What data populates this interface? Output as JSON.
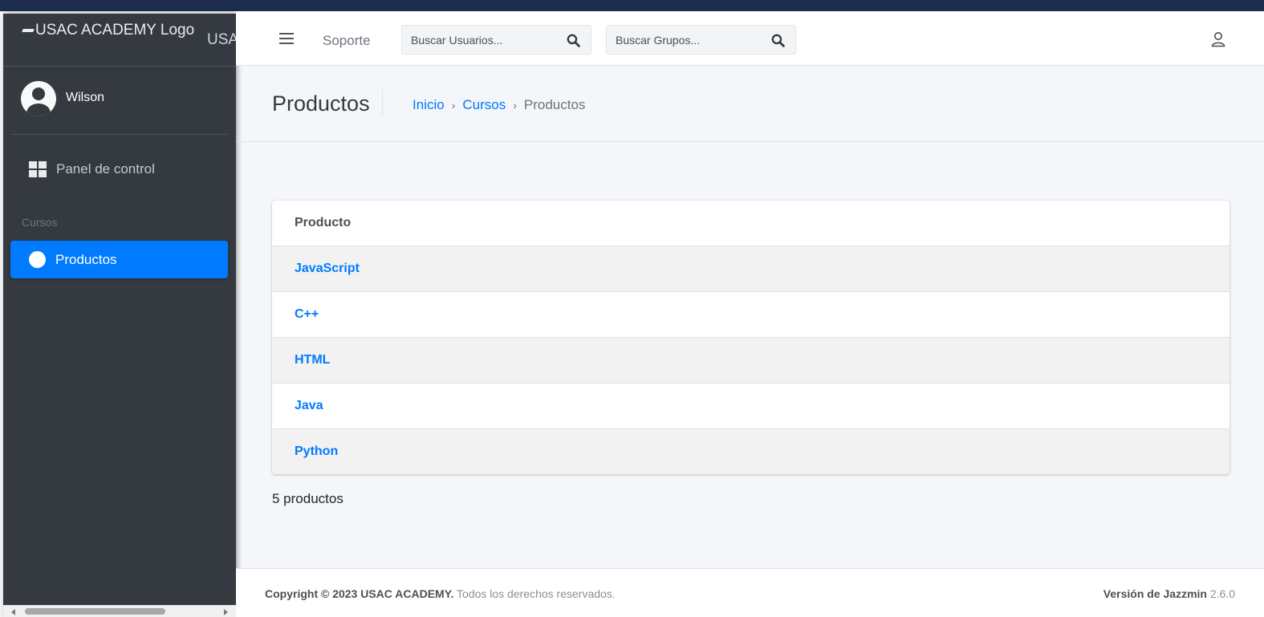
{
  "sidebar": {
    "brand_logo_alt": "USAC ACADEMY Logo",
    "brand_text": "USAC ACADEMY",
    "user_name": "Wilson",
    "dashboard_label": "Panel de control",
    "section_header": "Cursos",
    "active_item_label": "Productos"
  },
  "topnav": {
    "support_label": "Soporte",
    "search_users_placeholder": "Buscar Usuarios...",
    "search_groups_placeholder": "Buscar Grupos..."
  },
  "header": {
    "title": "Productos",
    "breadcrumb": [
      "Inicio",
      "Cursos",
      "Productos"
    ],
    "breadcrumb_sep": "›"
  },
  "table": {
    "header": "Producto",
    "rows": [
      "JavaScript",
      "C++",
      "HTML",
      "Java",
      "Python"
    ]
  },
  "result_count": "5 productos",
  "footer": {
    "copyright_bold": "Copyright © 2023 USAC ACADEMY.",
    "copyright_rest": " Todos los derechos reservados.",
    "version_bold": "Versión de Jazzmin",
    "version_number": " 2.6.0"
  },
  "colors": {
    "accent": "#007bff",
    "sidebar_bg": "#343a40",
    "outer_bg": "#1c2d4f"
  },
  "icons": [
    "hamburger-icon",
    "search-icon",
    "user-icon",
    "grid-icon",
    "circle-icon",
    "avatar-icon"
  ]
}
